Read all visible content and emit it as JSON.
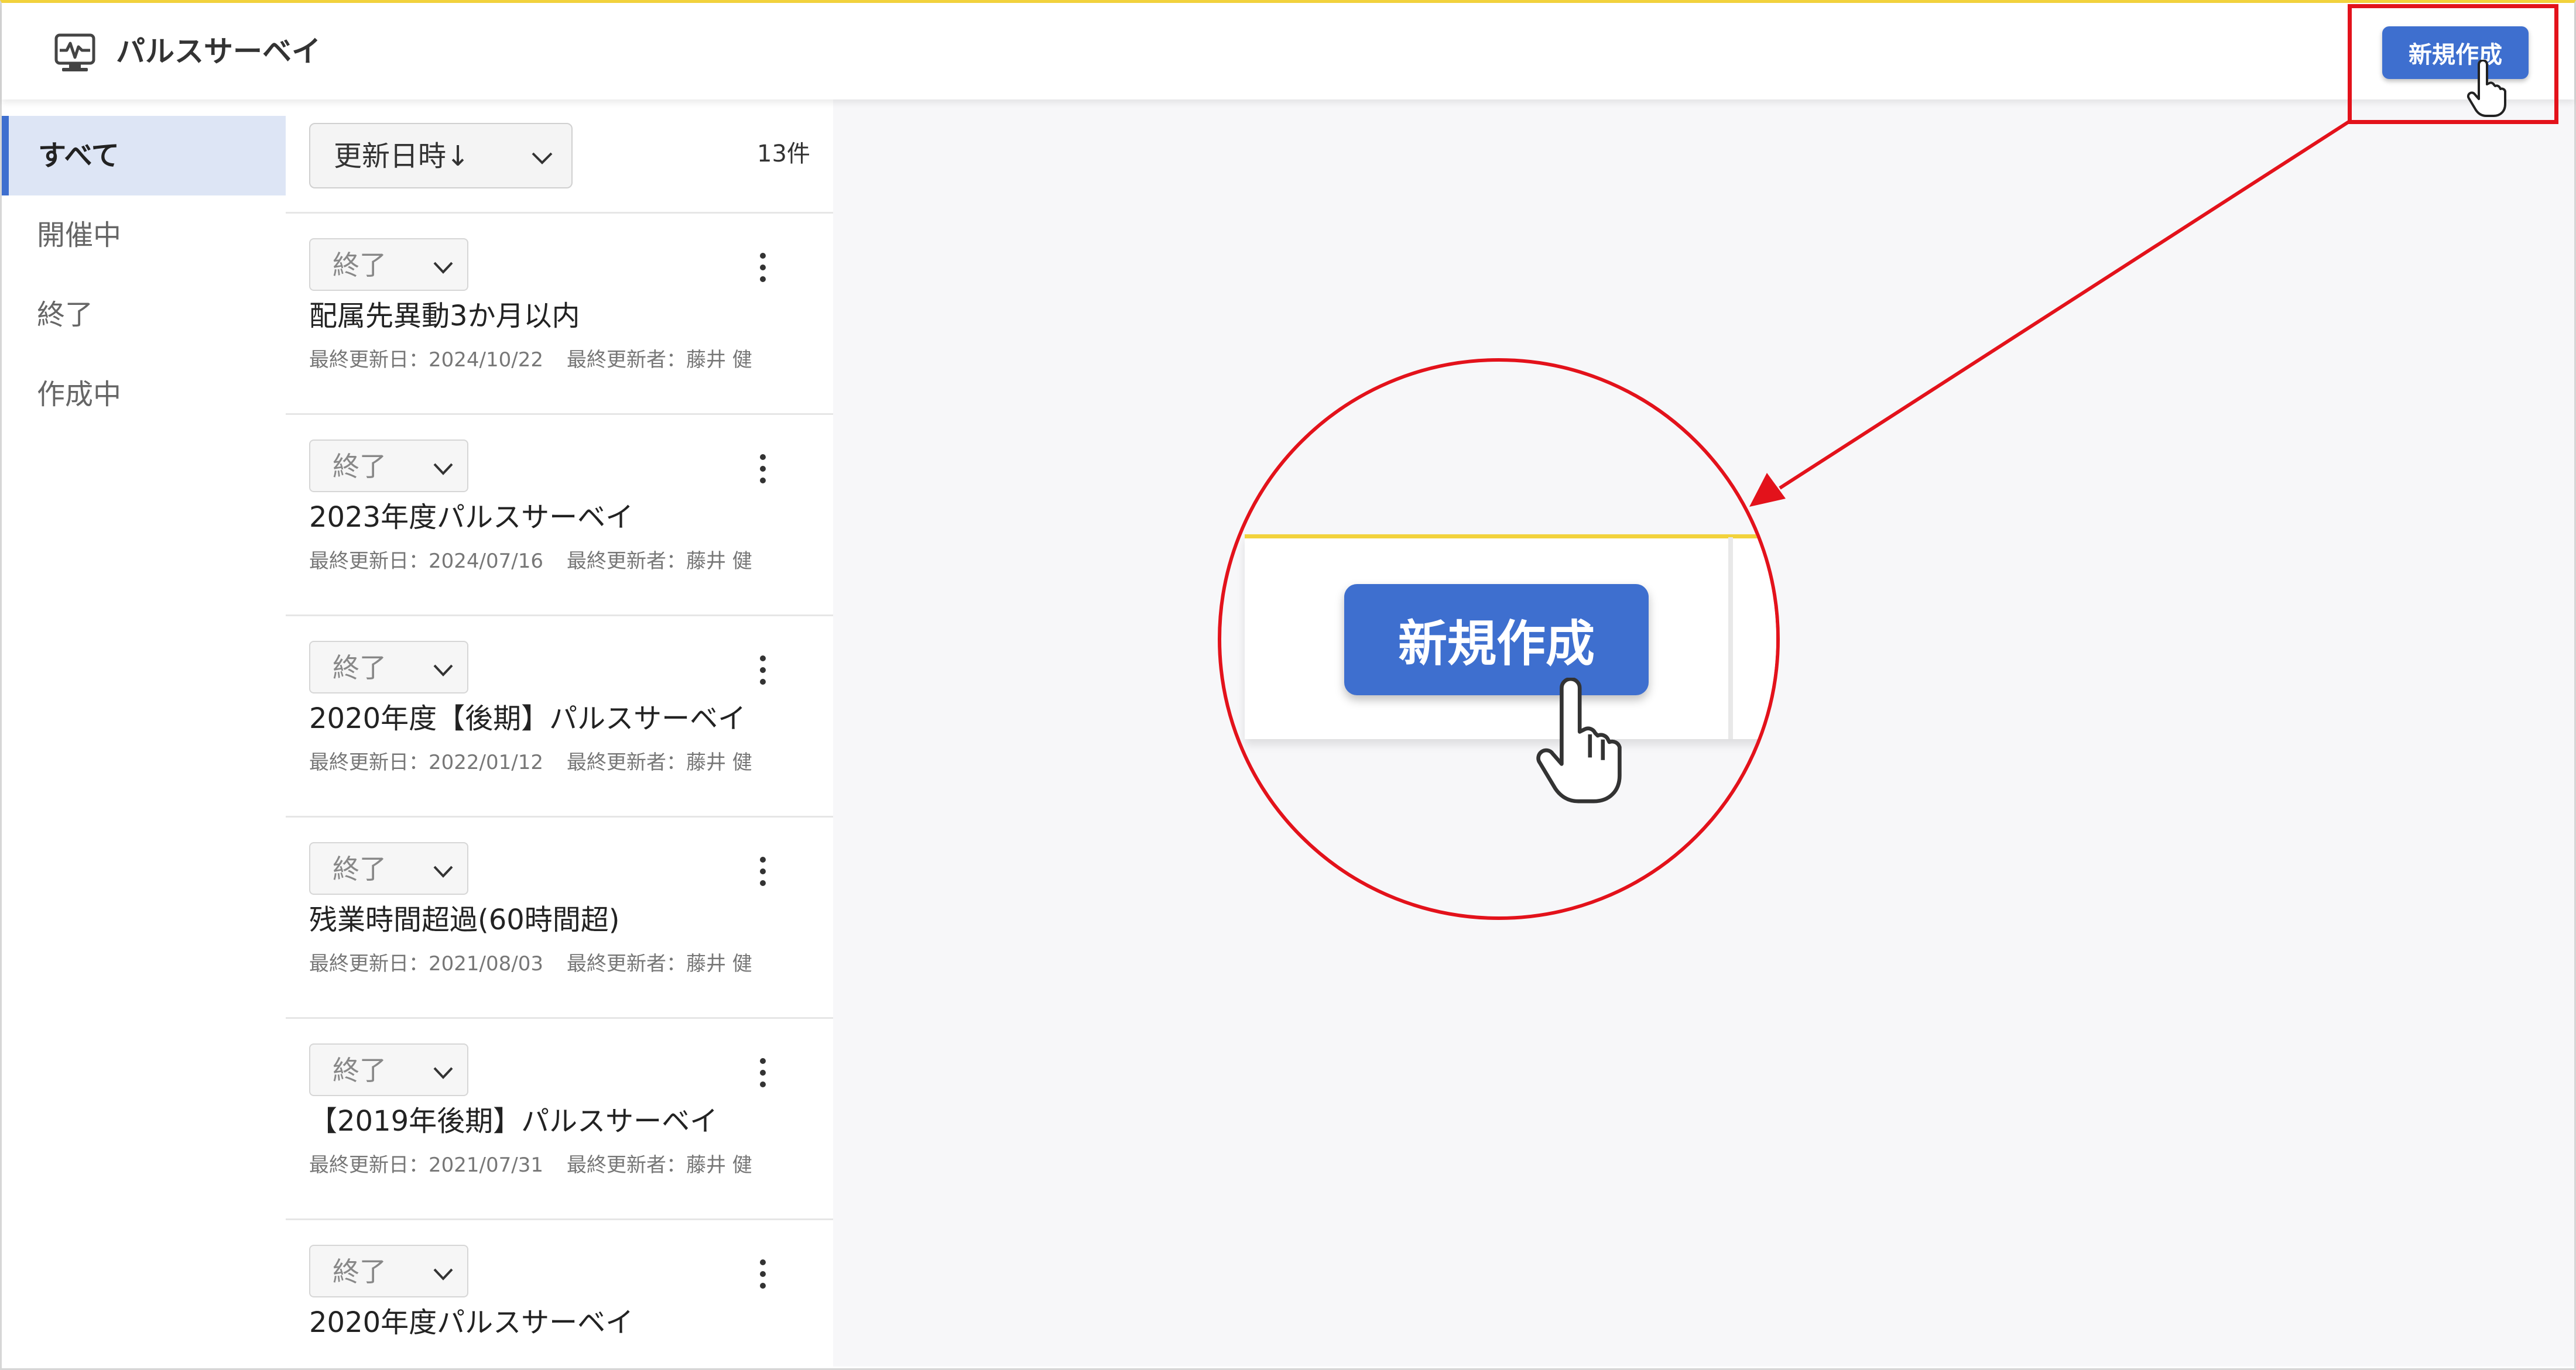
{
  "app": {
    "title": "パルスサーベイ",
    "icon": "pulse-monitor-icon"
  },
  "header": {
    "new_button_label": "新規作成"
  },
  "sidebar": {
    "items": [
      {
        "label": "すべて",
        "active": true
      },
      {
        "label": "開催中",
        "active": false
      },
      {
        "label": "終了",
        "active": false
      },
      {
        "label": "作成中",
        "active": false
      }
    ]
  },
  "list": {
    "sort_label": "更新日時↓",
    "count": "13件",
    "items": [
      {
        "status": "終了",
        "title": "配属先異動3か月以内",
        "updated": "最終更新日：2024/10/22",
        "updater": "最終更新者：藤井 健"
      },
      {
        "status": "終了",
        "title": "2023年度パルスサーベイ",
        "updated": "最終更新日：2024/07/16",
        "updater": "最終更新者：藤井 健"
      },
      {
        "status": "終了",
        "title": "2020年度【後期】パルスサーベイ",
        "updated": "最終更新日：2022/01/12",
        "updater": "最終更新者：藤井 健"
      },
      {
        "status": "終了",
        "title": "残業時間超過(60時間超)",
        "updated": "最終更新日：2021/08/03",
        "updater": "最終更新者：藤井 健"
      },
      {
        "status": "終了",
        "title": "【2019年後期】パルスサーベイ",
        "updated": "最終更新日：2021/07/31",
        "updater": "最終更新者：藤井 健"
      },
      {
        "status": "終了",
        "title": "2020年度パルスサーベイ",
        "updated": "",
        "updater": ""
      }
    ]
  },
  "callout": {
    "zoom_button_label": "新規作成"
  },
  "colors": {
    "accent": "#3e6fcf",
    "highlight": "#e3121b",
    "header_top": "#f2d23c"
  }
}
